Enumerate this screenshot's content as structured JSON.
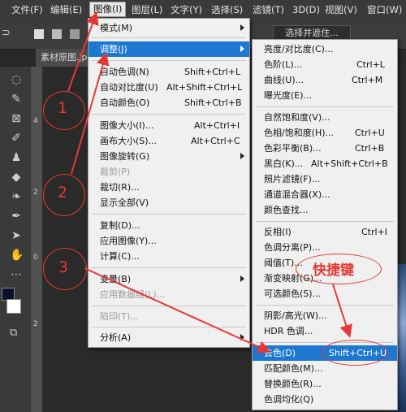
{
  "menubar": {
    "items": [
      {
        "label": "文件(F)"
      },
      {
        "label": "编辑(E)"
      },
      {
        "label": "图像(I)",
        "active": true
      },
      {
        "label": "图层(L)"
      },
      {
        "label": "文字(Y)"
      },
      {
        "label": "选择(S)"
      },
      {
        "label": "滤镜(T)"
      },
      {
        "label": "3D(D)"
      },
      {
        "label": "视图(V)"
      },
      {
        "label": "窗口(W)"
      }
    ]
  },
  "options_bar": {
    "select_mask_label": "选择并遮住..."
  },
  "document": {
    "tab_label": "素材原图.jpg"
  },
  "ruler": {
    "labels": [
      "4",
      "2",
      "0",
      "2"
    ]
  },
  "image_menu": [
    {
      "label": "模式(M)",
      "submenu": true
    },
    {
      "label": "调整(J)",
      "submenu": true,
      "highlighted": true
    },
    {
      "label": "自动色调(N)",
      "shortcut": "Shift+Ctrl+L"
    },
    {
      "label": "自动对比度(U)",
      "shortcut": "Alt+Shift+Ctrl+L"
    },
    {
      "label": "自动颜色(O)",
      "shortcut": "Shift+Ctrl+B"
    },
    {
      "label": "图像大小(I)...",
      "shortcut": "Alt+Ctrl+I"
    },
    {
      "label": "画布大小(S)...",
      "shortcut": "Alt+Ctrl+C"
    },
    {
      "label": "图像旋转(G)",
      "submenu": true
    },
    {
      "label": "裁剪(P)",
      "disabled": true
    },
    {
      "label": "裁切(R)..."
    },
    {
      "label": "显示全部(V)"
    },
    {
      "label": "复制(D)..."
    },
    {
      "label": "应用图像(Y)..."
    },
    {
      "label": "计算(C)..."
    },
    {
      "label": "变量(B)",
      "submenu": true
    },
    {
      "label": "应用数据组(L)...",
      "disabled": true
    },
    {
      "label": "陷印(T)...",
      "disabled": true
    },
    {
      "label": "分析(A)",
      "submenu": true
    }
  ],
  "adjust_menu": [
    {
      "label": "亮度/对比度(C)..."
    },
    {
      "label": "色阶(L)...",
      "shortcut": "Ctrl+L"
    },
    {
      "label": "曲线(U)...",
      "shortcut": "Ctrl+M"
    },
    {
      "label": "曝光度(E)..."
    },
    {
      "label": "自然饱和度(V)..."
    },
    {
      "label": "色相/饱和度(H)...",
      "shortcut": "Ctrl+U"
    },
    {
      "label": "色彩平衡(B)...",
      "shortcut": "Ctrl+B"
    },
    {
      "label": "黑白(K)...",
      "shortcut": "Alt+Shift+Ctrl+B"
    },
    {
      "label": "照片滤镜(F)..."
    },
    {
      "label": "通道混合器(X)..."
    },
    {
      "label": "颜色查找..."
    },
    {
      "label": "反相(I)",
      "shortcut": "Ctrl+I"
    },
    {
      "label": "色调分离(P)..."
    },
    {
      "label": "阈值(T)..."
    },
    {
      "label": "渐变映射(G)..."
    },
    {
      "label": "可选颜色(S)..."
    },
    {
      "label": "阴影/高光(W)..."
    },
    {
      "label": "HDR 色调..."
    },
    {
      "label": "去色(D)",
      "shortcut": "Shift+Ctrl+U",
      "highlighted": true
    },
    {
      "label": "匹配颜色(M)..."
    },
    {
      "label": "替换颜色(R)..."
    },
    {
      "label": "色调均化(Q)"
    }
  ],
  "annotations": {
    "circle_numbers": [
      "1",
      "2",
      "3"
    ],
    "shortcut_note": "快捷键",
    "color": "#e53935"
  },
  "colors": {
    "highlight": "#1e78d2",
    "menu_bg": "#f0f0f0"
  }
}
